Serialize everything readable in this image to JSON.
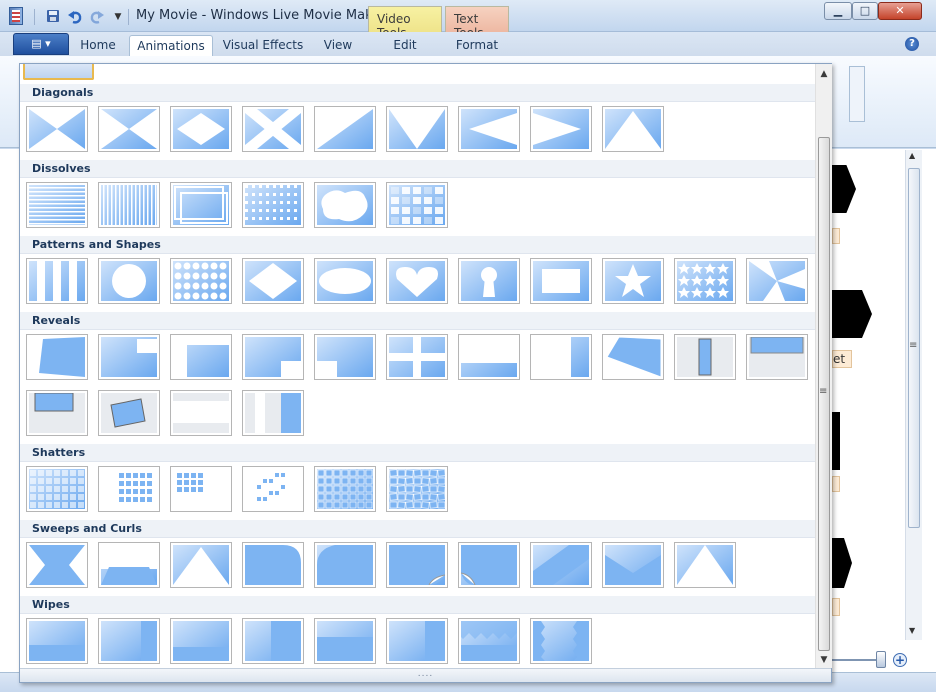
{
  "window": {
    "title": "My Movie - Windows Live Movie Maker",
    "minimize": "▁",
    "maximize": "□",
    "close": "✕"
  },
  "quick_access": {
    "save_icon": "save-icon",
    "undo_icon": "undo-icon",
    "redo_icon": "redo-icon",
    "customize_icon": "dropdown-icon"
  },
  "context_tabs": {
    "video_tools": "Video Tools",
    "text_tools": "Text Tools"
  },
  "ribbon_tabs": [
    "Home",
    "Animations",
    "Visual Effects",
    "View",
    "Edit",
    "Format"
  ],
  "active_tab": "Animations",
  "file_button_label": "▤ ▾",
  "help_label": "?",
  "background": {
    "label_fragment": "et"
  },
  "gallery": {
    "sections": [
      {
        "title": "Diagonals",
        "count": 9
      },
      {
        "title": "Dissolves",
        "count": 6
      },
      {
        "title": "Patterns and Shapes",
        "count": 11
      },
      {
        "title": "Reveals",
        "count": 15
      },
      {
        "title": "Shatters",
        "count": 6
      },
      {
        "title": "Sweeps and Curls",
        "count": 10
      },
      {
        "title": "Wipes",
        "count": 8
      }
    ],
    "scroll_up": "▲",
    "scroll_down": "▼",
    "grip": "....",
    "accent_blue": "#7db4f2",
    "tile_border": "#b5b5b5",
    "selected_border": "#e8b94f"
  },
  "zoom_plus": "+",
  "bg_scroll_up": "▲",
  "bg_scroll_down": "▼",
  "bg_scroll_grip": "≡"
}
